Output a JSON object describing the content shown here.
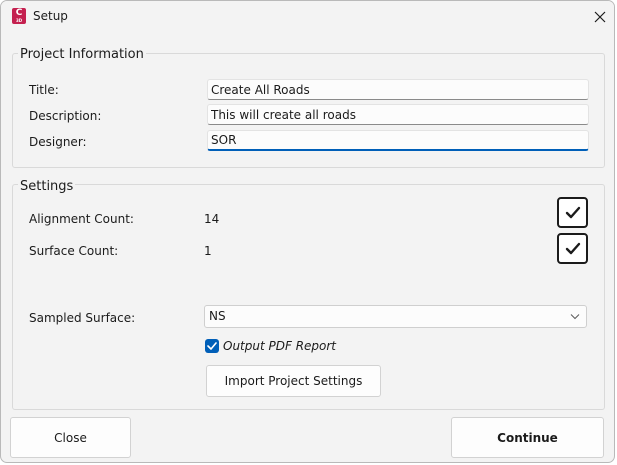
{
  "window": {
    "title": "Setup",
    "app_icon_letter": "C",
    "app_icon_sub": "3D"
  },
  "project_info": {
    "legend": "Project Information",
    "title_label": "Title:",
    "title_value": "Create All Roads",
    "description_label": "Description:",
    "description_value": "This will create all roads",
    "designer_label": "Designer:",
    "designer_value": "SOR"
  },
  "settings": {
    "legend": "Settings",
    "alignment_count_label": "Alignment Count:",
    "alignment_count_value": "14",
    "alignment_checked": true,
    "surface_count_label": "Surface Count:",
    "surface_count_value": "1",
    "surface_checked": true,
    "sampled_surface_label": "Sampled Surface:",
    "sampled_surface_value": "NS",
    "output_pdf_label": "Output PDF Report",
    "output_pdf_checked": true,
    "import_button": "Import Project Settings"
  },
  "footer": {
    "close_button": "Close",
    "continue_button": "Continue"
  },
  "colors": {
    "accent": "#005fb8",
    "app_icon": "#c4204f"
  }
}
